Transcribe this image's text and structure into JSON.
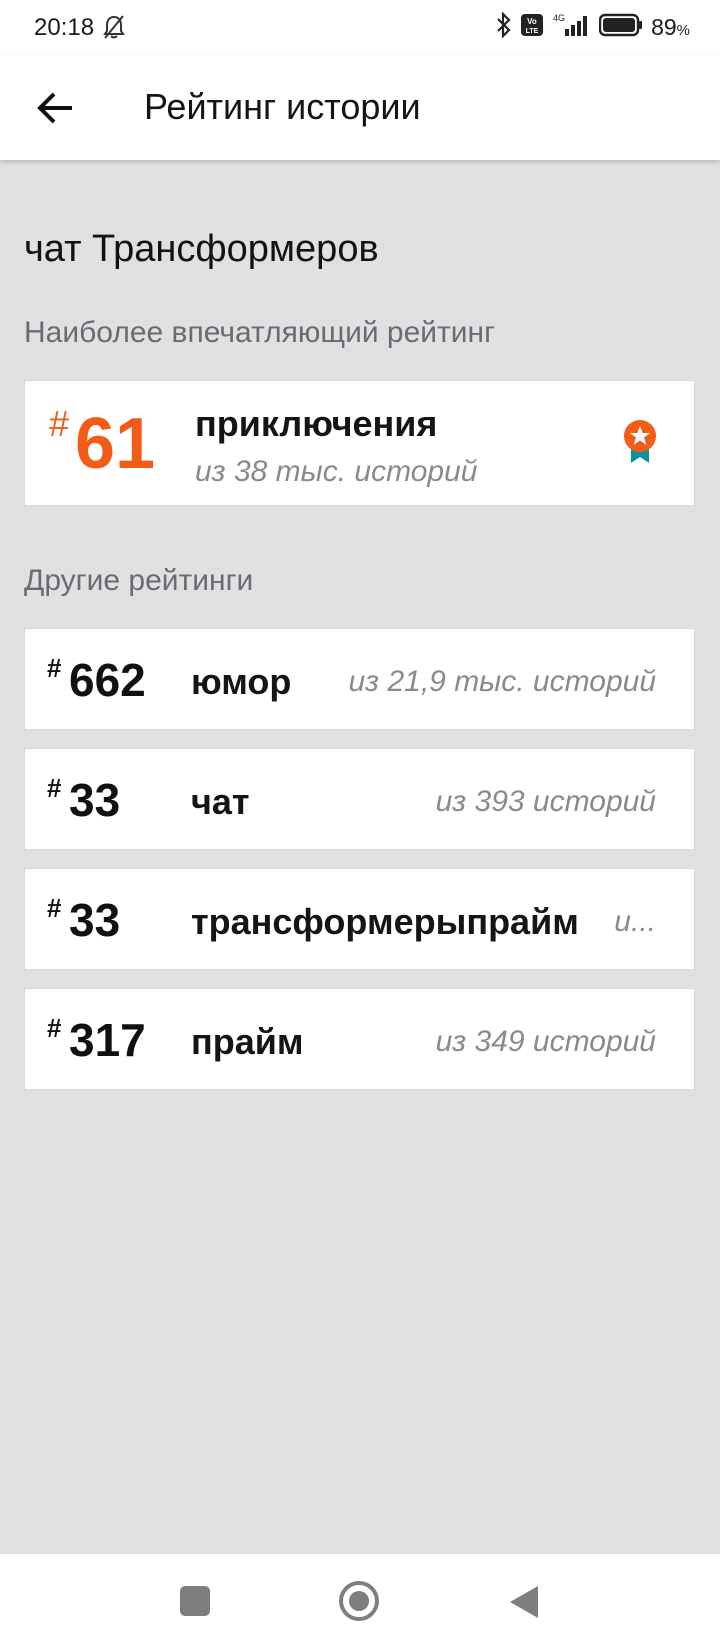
{
  "status_bar": {
    "time": "20:18",
    "battery_percent": "89",
    "battery_unit": "%",
    "network": "4G",
    "volte": "Vo LTE",
    "icons": [
      "bell-off-icon",
      "bluetooth-icon",
      "volte-icon",
      "signal-icon",
      "battery-icon"
    ]
  },
  "header": {
    "title": "Рейтинг истории",
    "back_icon": "arrow-left-icon"
  },
  "story": {
    "title": "чат Трансформеров"
  },
  "featured_section": {
    "label": "Наиболее впечатляющий рейтинг",
    "hash": "#",
    "rank": "61",
    "tag": "приключения",
    "subtitle": "из 38 тыс. историй",
    "badge_icon": "award-medal-icon",
    "accent_color": "#f25c19"
  },
  "other_section": {
    "label": "Другие рейтинги",
    "items": [
      {
        "hash": "#",
        "rank": "662",
        "tag": "юмор",
        "subtitle": "из 21,9 тыс. историй"
      },
      {
        "hash": "#",
        "rank": "33",
        "tag": "чат",
        "subtitle": "из 393 историй"
      },
      {
        "hash": "#",
        "rank": "33",
        "tag": "трансформерыпрайм",
        "subtitle": "и..."
      },
      {
        "hash": "#",
        "rank": "317",
        "tag": "прайм",
        "subtitle": "из 349 историй"
      }
    ]
  },
  "nav_bar": {
    "icons": [
      "recents-square-icon",
      "home-circle-icon",
      "back-triangle-icon"
    ]
  }
}
